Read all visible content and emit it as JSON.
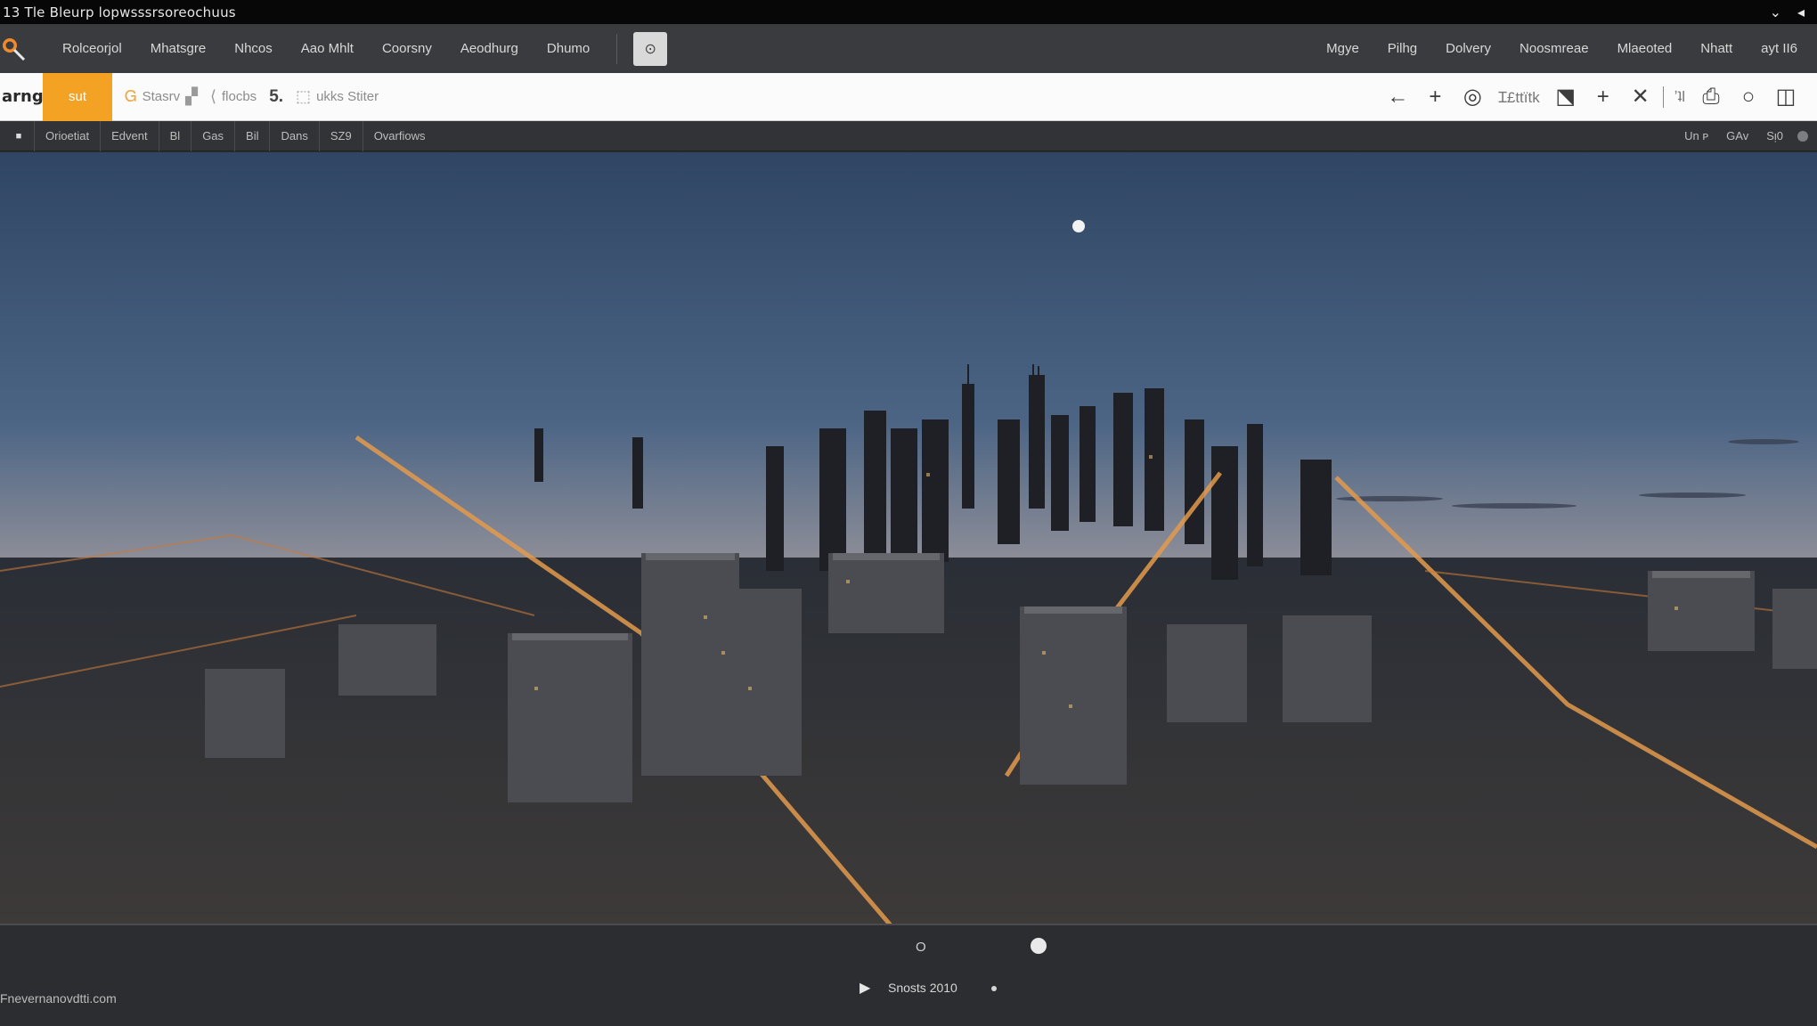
{
  "window": {
    "title": "13 Tle Bleurp lopwsssrsoreochuus",
    "controls": [
      "⌄",
      "◂"
    ]
  },
  "menu": {
    "left": [
      "Rolceorjol",
      "Mhatsgre",
      "Nhcos",
      "Aao Mhlt",
      "Coorsny",
      "Aeodhurg",
      "Dhumo"
    ],
    "app_button_icon": "⊙",
    "right": [
      "Mgye",
      "Pilhg",
      "Dolvery",
      "Noosmreae",
      "Mlaeoted",
      "Nhatt",
      "ayt ІІ6"
    ]
  },
  "toolbar": {
    "brand": "arng",
    "active_tab": "sut",
    "tools": [
      {
        "icon": "Ꮐ",
        "label": "Stasrv"
      },
      {
        "icon": "⟨",
        "label": "flocbs"
      },
      {
        "icon": "",
        "label": "5."
      },
      {
        "icon": "⬚",
        "label": "ukks Stiter"
      }
    ],
    "right_text": "Ɪ£ttїtk",
    "right_text2": "ʼʇl"
  },
  "subbar": {
    "items": [
      "Orioetiat",
      "Edvent",
      "Bl",
      "Gas",
      "Bil",
      "Dans",
      "SZ9",
      "Ovarfiows"
    ],
    "right": [
      "Un ᴘ",
      "GAv",
      "Sᴉ0"
    ]
  },
  "bottom": {
    "marker_label": "O",
    "status": "Snosts 2010",
    "url": "Fnevernanovdtti.com"
  },
  "colors": {
    "accent": "#f3a224",
    "sky_top": "#2f4563",
    "sky_horizon": "#f2843a"
  }
}
